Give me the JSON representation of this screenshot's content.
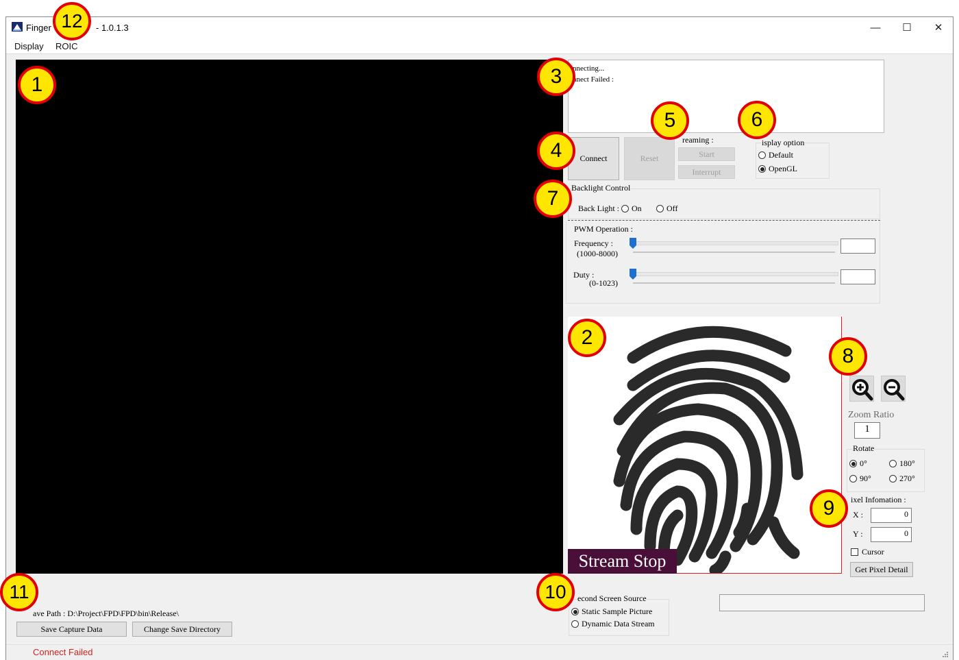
{
  "window": {
    "title_prefix": "Finger",
    "title_suffix": "- 1.0.1.3",
    "minimize_symbol": "—",
    "maximize_symbol": "☐",
    "close_symbol": "✕"
  },
  "menu": [
    "Display",
    "ROIC"
  ],
  "log": {
    "lines": [
      "nnecting...",
      "nnect Failed   :"
    ]
  },
  "buttons": {
    "connect": "Connect",
    "reset": "Reset",
    "start": "Start",
    "interrupt": "Interrupt",
    "save_capture": "Save Capture Data",
    "change_dir": "Change Save Directory",
    "get_pixel_detail": "Get Pixel Detail"
  },
  "streaming_label": "reaming :",
  "display_option": {
    "label": "isplay option",
    "options": [
      "Default",
      "OpenGL"
    ],
    "selected": "OpenGL"
  },
  "backlight": {
    "title": "Backlight Control",
    "label": "Back Light :",
    "on": "On",
    "off": "Off"
  },
  "pwm": {
    "title": "PWM Operation :",
    "frequency_label": "Frequency :",
    "frequency_range": "(1000-8000)",
    "duty_label": "Duty :",
    "duty_range": "(0-1023)",
    "frequency_value": "",
    "duty_value": ""
  },
  "preview": {
    "overlay": "Stream Stop"
  },
  "zoom": {
    "label": "Zoom Ratio",
    "value": "1",
    "zoom_in_icon": "zoom-in-icon",
    "zoom_out_icon": "zoom-out-icon"
  },
  "rotate": {
    "label": "Rotate",
    "options": [
      "0°",
      "180°",
      "90°",
      "270°"
    ],
    "selected": "0°"
  },
  "pixel_info": {
    "label": "ixel Infomation :",
    "x_label": "X :",
    "y_label": "Y :",
    "x_value": "0",
    "y_value": "0",
    "cursor_label": "Cursor"
  },
  "second_screen": {
    "label": "econd Screen Source",
    "options": [
      "Static Sample Picture",
      "Dynamic Data Stream"
    ],
    "selected": "Static Sample Picture"
  },
  "save_path": "ave Path : D:\\Project\\FPD\\FPD\\bin\\Release\\",
  "status": {
    "text": "Connect Failed",
    "color": "#d42020"
  },
  "annotations": [
    "1",
    "2",
    "3",
    "4",
    "5",
    "6",
    "7",
    "8",
    "9",
    "10",
    "11",
    "12"
  ],
  "colors": {
    "accent_blue": "#1f6fd1",
    "badge_fill": "#ffe600",
    "badge_border": "#e20000",
    "overlay_bg": "#4a0f38"
  }
}
